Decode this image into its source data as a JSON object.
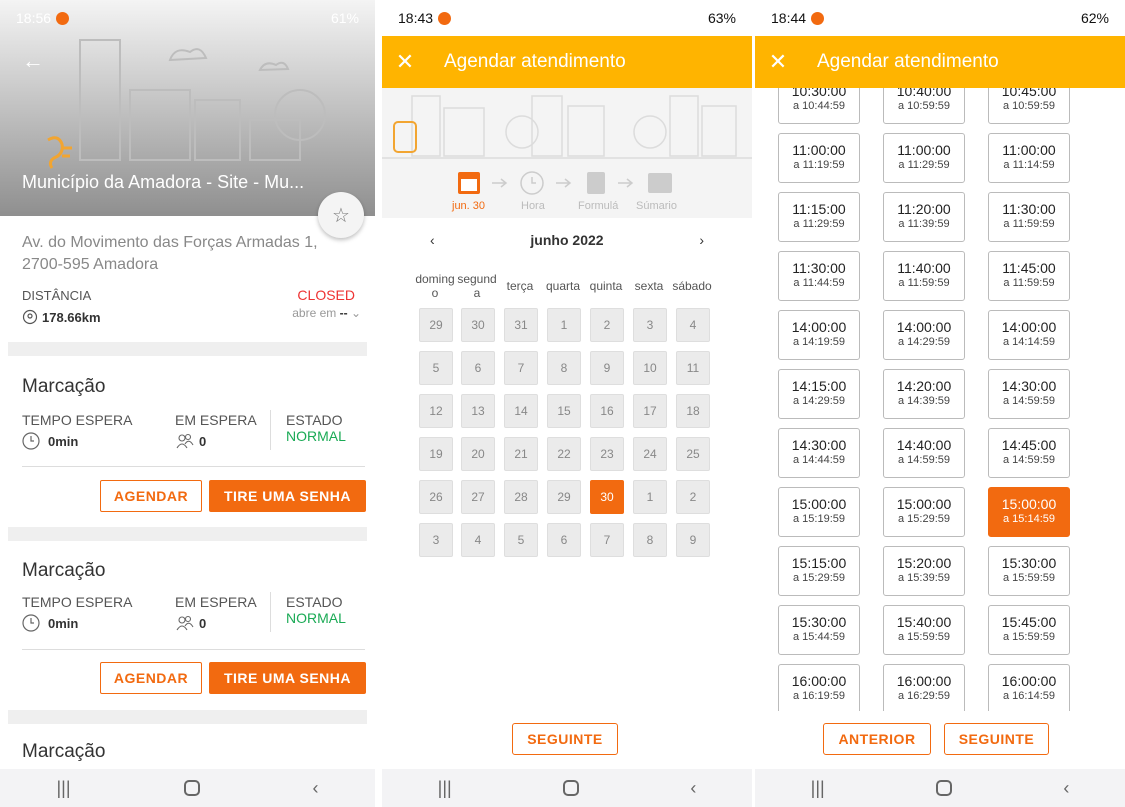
{
  "panel1": {
    "status": {
      "time": "18:56",
      "right": "61%"
    },
    "title": "Município da Amadora - Site - Mu...",
    "address": "Av. do Movimento das Forças Armadas 1, 2700-595 Amadora",
    "distance_label": "DISTÂNCIA",
    "distance_value": "178.66km",
    "closed_label": "CLOSED",
    "opens_label": "abre em",
    "opens_value": "--",
    "cards": [
      {
        "title": "Marcação",
        "wait_label": "TEMPO ESPERA",
        "wait_value": "0min",
        "queue_label": "EM ESPERA",
        "queue_value": "0",
        "state_label": "ESTADO",
        "state_value": "NORMAL",
        "btn_schedule": "AGENDAR",
        "btn_ticket": "TIRE UMA SENHA"
      },
      {
        "title": "Marcação",
        "wait_label": "TEMPO ESPERA",
        "wait_value": "0min",
        "queue_label": "EM ESPERA",
        "queue_value": "0",
        "state_label": "ESTADO",
        "state_value": "NORMAL",
        "btn_schedule": "AGENDAR",
        "btn_ticket": "TIRE UMA SENHA"
      },
      {
        "title": "Marcação"
      }
    ]
  },
  "panel2": {
    "status": {
      "time": "18:43",
      "right": "63%"
    },
    "appbar_title": "Agendar atendimento",
    "steps": [
      "jun. 30",
      "Hora",
      "Formulá",
      "Súmario"
    ],
    "month": "junho 2022",
    "weekdays": [
      "doming o",
      "segund a",
      "terça",
      "quarta",
      "quinta",
      "sexta",
      "sábado"
    ],
    "days": [
      "29",
      "30",
      "31",
      "1",
      "2",
      "3",
      "4",
      "5",
      "6",
      "7",
      "8",
      "9",
      "10",
      "11",
      "12",
      "13",
      "14",
      "15",
      "16",
      "17",
      "18",
      "19",
      "20",
      "21",
      "22",
      "23",
      "24",
      "25",
      "26",
      "27",
      "28",
      "29",
      "30",
      "1",
      "2",
      "3",
      "4",
      "5",
      "6",
      "7",
      "8",
      "9"
    ],
    "selected_index": 32,
    "next_label": "SEGUINTE"
  },
  "panel3": {
    "status": {
      "time": "18:44",
      "right": "62%"
    },
    "appbar_title": "Agendar atendimento",
    "slots": [
      [
        {
          "s": "10:30:00",
          "e": "a 10:44:59"
        },
        {
          "s": "10:40:00",
          "e": "a 10:59:59"
        },
        {
          "s": "10:45:00",
          "e": "a 10:59:59"
        }
      ],
      [
        {
          "s": "11:00:00",
          "e": "a 11:19:59"
        },
        {
          "s": "11:00:00",
          "e": "a 11:29:59"
        },
        {
          "s": "11:00:00",
          "e": "a 11:14:59"
        }
      ],
      [
        {
          "s": "11:15:00",
          "e": "a 11:29:59"
        },
        {
          "s": "11:20:00",
          "e": "a 11:39:59"
        },
        {
          "s": "11:30:00",
          "e": "a 11:59:59"
        }
      ],
      [
        {
          "s": "11:30:00",
          "e": "a 11:44:59"
        },
        {
          "s": "11:40:00",
          "e": "a 11:59:59"
        },
        {
          "s": "11:45:00",
          "e": "a 11:59:59"
        }
      ],
      [
        {
          "s": "14:00:00",
          "e": "a 14:19:59"
        },
        {
          "s": "14:00:00",
          "e": "a 14:29:59"
        },
        {
          "s": "14:00:00",
          "e": "a 14:14:59"
        }
      ],
      [
        {
          "s": "14:15:00",
          "e": "a 14:29:59"
        },
        {
          "s": "14:20:00",
          "e": "a 14:39:59"
        },
        {
          "s": "14:30:00",
          "e": "a 14:59:59"
        }
      ],
      [
        {
          "s": "14:30:00",
          "e": "a 14:44:59"
        },
        {
          "s": "14:40:00",
          "e": "a 14:59:59"
        },
        {
          "s": "14:45:00",
          "e": "a 14:59:59"
        }
      ],
      [
        {
          "s": "15:00:00",
          "e": "a 15:19:59"
        },
        {
          "s": "15:00:00",
          "e": "a 15:29:59"
        },
        {
          "s": "15:00:00",
          "e": "a 15:14:59",
          "selected": true
        }
      ],
      [
        {
          "s": "15:15:00",
          "e": "a 15:29:59"
        },
        {
          "s": "15:20:00",
          "e": "a 15:39:59"
        },
        {
          "s": "15:30:00",
          "e": "a 15:59:59"
        }
      ],
      [
        {
          "s": "15:30:00",
          "e": "a 15:44:59"
        },
        {
          "s": "15:40:00",
          "e": "a 15:59:59"
        },
        {
          "s": "15:45:00",
          "e": "a 15:59:59"
        }
      ],
      [
        {
          "s": "16:00:00",
          "e": "a 16:19:59"
        },
        {
          "s": "16:00:00",
          "e": "a 16:29:59"
        },
        {
          "s": "16:00:00",
          "e": "a 16:14:59"
        }
      ]
    ],
    "prev_label": "ANTERIOR",
    "next_label": "SEGUINTE"
  },
  "colors": {
    "accent": "#f26a10",
    "appbar": "#ffb400",
    "normal": "#1aaa55",
    "closed": "#e33333"
  },
  "icons": {
    "back": "arrow-left-icon",
    "star": "star-outline-icon",
    "close": "close-icon",
    "clock": "clock-icon",
    "people": "people-icon",
    "location": "location-pin-icon",
    "chevron": "chevron-down-icon"
  }
}
